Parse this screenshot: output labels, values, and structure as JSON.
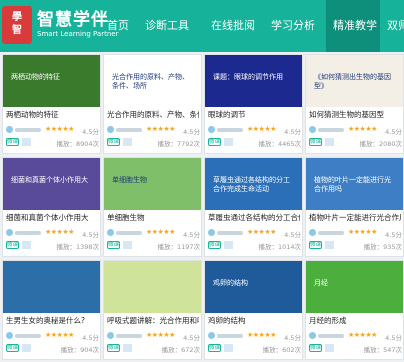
{
  "header": {
    "logo_chars": [
      "學",
      "智",
      "伴",
      "慧"
    ],
    "brand_name": "智慧学伴",
    "brand_sub": "Smart Learning Partner",
    "nav": [
      {
        "label": "首页",
        "active": false
      },
      {
        "label": "诊断工具",
        "active": false
      },
      {
        "label": "在线批阅",
        "active": false
      },
      {
        "label": "学习分析",
        "active": false
      },
      {
        "label": "精准教学",
        "active": true
      },
      {
        "label": "双师服务",
        "active": false
      }
    ]
  },
  "colors": {
    "header": "#16b39a",
    "active_tab": "#0e8f7b",
    "stars": "#f5a623",
    "badge": "#19b49b"
  },
  "badge_label": "微课",
  "cards": [
    {
      "title": "两栖动物的特征",
      "score": "4.5分",
      "views": "播放：8904次",
      "thumb_text": "两栖动物的特征",
      "thumb_bg": "#3a7a2c"
    },
    {
      "title": "光合作用的原料、产物、条件、场所",
      "score": "4.5分",
      "views": "播放：7792次",
      "thumb_text": "光合作用的原料、产物、条件、场所",
      "thumb_bg": "#ffffff"
    },
    {
      "title": "眼球的调节",
      "score": "4.5分",
      "views": "播放：4465次",
      "thumb_text": "课题：眼球的调节作用",
      "thumb_bg": "#1c2a8f"
    },
    {
      "title": "如何猜测生物的基因型",
      "score": "4.5分",
      "views": "播放：2080次",
      "thumb_text": "《如何猜测出生物的基因型》",
      "thumb_bg": "#f3efe6"
    },
    {
      "title": "细菌和真菌个体小作用大",
      "score": "4.5分",
      "views": "播放：1398次",
      "thumb_text": "细菌和真菌个体小作用大",
      "thumb_bg": "#5a4a9a"
    },
    {
      "title": "单细胞生物",
      "score": "4.5分",
      "views": "播放：1197次",
      "thumb_text": "单细胞生物",
      "thumb_bg": "#7fbf6a"
    },
    {
      "title": "草履虫通过各结构的分工合作完成",
      "score": "4.5分",
      "views": "播放：1014次",
      "thumb_text": "草履虫通过各结构的分工合作完成生命活动",
      "thumb_bg": "#2a6fb8"
    },
    {
      "title": "植物叶片一定能进行光合作用吗",
      "score": "4.5分",
      "views": "播放：935次",
      "thumb_text": "植物的叶片一定能进行光合作用吗",
      "thumb_bg": "#3d7ec4"
    },
    {
      "title": "生男生女的奥秘是什么?",
      "score": "4.5分",
      "views": "播放：904次",
      "thumb_text": "",
      "thumb_bg": "#2c6fa8"
    },
    {
      "title": "呼吸式题讲解：光合作用和呼吸作",
      "score": "4.5分",
      "views": "播放：672次",
      "thumb_text": "",
      "thumb_bg": "#cfe39a"
    },
    {
      "title": "鸡卵的结构",
      "score": "4.5分",
      "views": "播放：602次",
      "thumb_text": "鸡卵的结构",
      "thumb_bg": "#1f5a9a"
    },
    {
      "title": "月经的形成",
      "score": "4.5分",
      "views": "播放：547次",
      "thumb_text": "月经",
      "thumb_bg": "#4cae3c"
    }
  ]
}
